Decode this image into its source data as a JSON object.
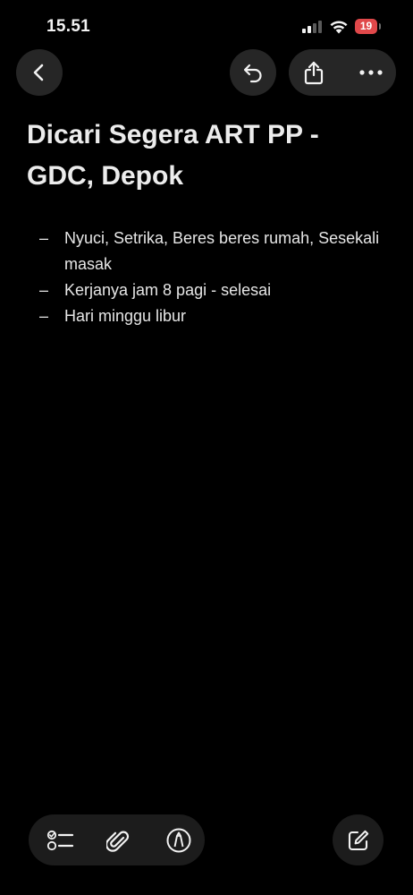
{
  "status_bar": {
    "time": "15.51",
    "battery_level": "19",
    "battery_color": "#e0484a",
    "signal_bars_active": 2,
    "signal_bars_total": 4
  },
  "nav": {
    "back_icon": "chevron-left-icon",
    "undo_icon": "undo-icon",
    "share_icon": "share-icon",
    "more_icon": "ellipsis-icon"
  },
  "note": {
    "title": "Dicari Segera ART PP - GDC, Depok",
    "bullet": "–",
    "items": [
      "Nyuci, Setrika, Beres beres rumah, Sesekali masak",
      "Kerjanya jam 8 pagi - selesai",
      "Hari minggu libur"
    ]
  },
  "toolbar": {
    "checklist_icon": "checklist-icon",
    "attachment_icon": "paperclip-icon",
    "markup_icon": "pen-markup-icon",
    "compose_icon": "compose-icon"
  },
  "colors": {
    "background": "#000000",
    "button_bg": "#262626",
    "toolbar_bg": "#1c1c1c",
    "text": "#e9e9e9"
  }
}
